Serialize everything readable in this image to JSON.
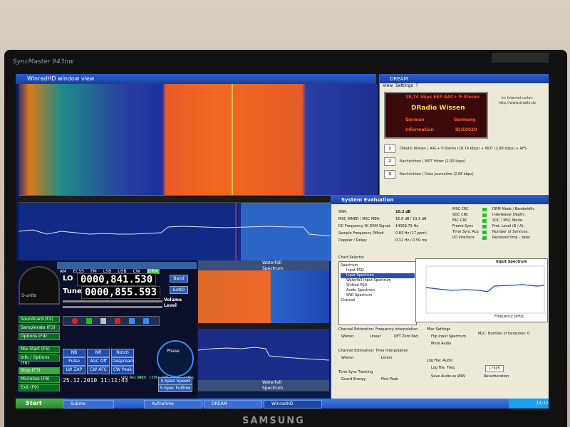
{
  "monitor": {
    "brand": "SyncMaster 943nw",
    "maker": "SAMSUNG"
  },
  "waterfall_window": {
    "title": "WinradHD window view"
  },
  "receiver": {
    "lo_label": "LO",
    "lo_value": "0000,841.530",
    "tune_label": "Tune",
    "tune_value": "0000,855.593",
    "volume_label": "Volume",
    "level_label": "Level",
    "band_button": "Band",
    "extio_button": "ExtIO",
    "smeter_label": "S-units",
    "side_buttons": [
      "Soundcard (F2)",
      "Samplerate (F3)",
      "Options (F4)",
      "Mix Start (F5)",
      "Info / Options (F6)",
      "Stop (F7)",
      "Minimise (F8)",
      "Exit (F9)"
    ],
    "mode_tabs": [
      "AM",
      "ECSS",
      "FM",
      "LSB",
      "USB",
      "CW",
      "DRM"
    ],
    "demod_buttons": [
      "NB",
      "NR",
      "Notch",
      "Pulse",
      "AGC Off",
      "Despread",
      "LW ZAP",
      "CW AFC",
      "CW Peak"
    ],
    "datetime": "25.12.2010 11:11:43",
    "cpu_text": "CPU Rec(WRD) (33%)  CPU Total (20%)",
    "phase_label": "Phase",
    "speed_labels": [
      "S.Spec Speed",
      "S.Spec Fullhiw"
    ],
    "panel_titles": {
      "waterfall": "Waterfall",
      "rbw": "RBW",
      "spectrum": "Spectrum"
    }
  },
  "dream": {
    "title": "DREAM",
    "menu": [
      "View",
      "Settings",
      "?"
    ],
    "lcd_header": "18,74 kbps EEP AAC+ P-Stereo",
    "station": "DRadio Wissen",
    "language": "German",
    "country": "Germany",
    "program": "Information",
    "service_id": "ID:E0020",
    "internet_text": "Im Internet unter: http://www.dradio.de",
    "services": [
      {
        "num": "1",
        "text": "DRadio Wissen | AAC+ P-Stereo (18,74 kbps) + MOT (2,88 kbps) + AFS"
      },
      {
        "num": "2",
        "text": "Nachrichten | MOT Hörer (2,00 kbps)"
      },
      {
        "num": "3",
        "text": "Nachrichten | Data Journaline (2,88 kbps)"
      }
    ]
  },
  "system_evaluation": {
    "title": "System Evaluation",
    "snr_label": "SNR:",
    "snr_value": "10.3 dB",
    "mscwmer_label": "MSC WMER / MSC MER:",
    "mscwmer_value": "16.8 dB / 13.5 dB",
    "dcfreq_label": "DC Frequency Of DRM Signal:",
    "dcfreq_value": "14069.79 Hz",
    "sampleoff_label": "Sample Frequency Offset:",
    "sampleoff_value": "0.83 Hz (17 ppm)",
    "doppler_label": "Doppler / Delay:",
    "doppler_value": "0.11 Hz / 0.59 ms",
    "crc_labels": [
      "MSC CRC",
      "SDC CRC",
      "FAC CRC",
      "Frame Sync",
      "Time Sync Acq",
      "I/O Interface"
    ],
    "mode_labels": [
      "DRM Mode / Bandwidth:",
      "Interleaver Depth:",
      "SDC / MSC Mode:",
      "Prot. Level (B / A):",
      "Number of Services:",
      "Received time - date:"
    ],
    "chart_selector_label": "Chart Selector",
    "tree_items": [
      "Spectrum",
      "Input PSD",
      "Input Spectrum",
      "Waterfall Input Spectrum",
      "Shifted PSD",
      "Audio Spectrum",
      "SNR Spectrum",
      "Channel"
    ],
    "plot_title": "Input Spectrum",
    "plot_xlabel": "Frequency [kHz]",
    "plot_ylabel": "Input Spectrum [dB]",
    "interp_freq_label": "Channel Estimation: Frequency Interpolation",
    "interp_freq_opts": [
      "Wiener",
      "Linear",
      "DFT Zero Pad"
    ],
    "interp_time_label": "Channel Estimation: Time Interpolation",
    "interp_time_opts": [
      "Wiener",
      "Linear"
    ],
    "timesync_label": "Time Sync Tracking",
    "timesync_opts": [
      "Guard Energy",
      "First Peak"
    ],
    "misc_label": "Misc Settings",
    "misc_opts": [
      "Flip Input Spectrum",
      "Mute Audio"
    ],
    "mlc_label": "MLC: Number of Iterations: 0",
    "logfile_label": "Log File: Audio",
    "logfile_opts": [
      "Log File, Freq.",
      "Save Audio as WAV",
      "Reverberation"
    ],
    "logfreq_value": "17505"
  },
  "taskbar": {
    "start": "Start",
    "tasks": [
      "Subme",
      "Aufnahme",
      "DREAM",
      "WinradHD"
    ],
    "clock": "11:11"
  }
}
